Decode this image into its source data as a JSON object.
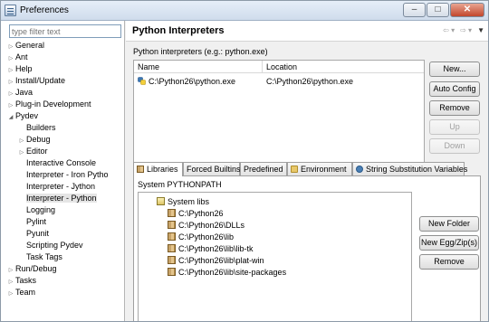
{
  "window": {
    "title": "Preferences"
  },
  "filter": {
    "placeholder": "type filter text"
  },
  "tree": [
    {
      "label": "General",
      "arrow": "▷"
    },
    {
      "label": "Ant",
      "arrow": "▷"
    },
    {
      "label": "Help",
      "arrow": "▷"
    },
    {
      "label": "Install/Update",
      "arrow": "▷"
    },
    {
      "label": "Java",
      "arrow": "▷"
    },
    {
      "label": "Plug-in Development",
      "arrow": "▷"
    },
    {
      "label": "Pydev",
      "arrow": "◢"
    },
    {
      "label": "Builders",
      "arrow": ""
    },
    {
      "label": "Debug",
      "arrow": "▷"
    },
    {
      "label": "Editor",
      "arrow": "▷"
    },
    {
      "label": "Interactive Console",
      "arrow": ""
    },
    {
      "label": "Interpreter - Iron Pytho",
      "arrow": ""
    },
    {
      "label": "Interpreter - Jython",
      "arrow": ""
    },
    {
      "label": "Interpreter - Python",
      "arrow": ""
    },
    {
      "label": "Logging",
      "arrow": ""
    },
    {
      "label": "Pylint",
      "arrow": ""
    },
    {
      "label": "Pyunit",
      "arrow": ""
    },
    {
      "label": "Scripting Pydev",
      "arrow": ""
    },
    {
      "label": "Task Tags",
      "arrow": ""
    },
    {
      "label": "Run/Debug",
      "arrow": "▷"
    },
    {
      "label": "Tasks",
      "arrow": "▷"
    },
    {
      "label": "Team",
      "arrow": "▷"
    }
  ],
  "page": {
    "title": "Python Interpreters",
    "interpreters_label": "Python interpreters (e.g.: python.exe)",
    "table": {
      "headers": [
        "Name",
        "Location"
      ],
      "rows": [
        {
          "name": "C:\\Python26\\python.exe",
          "location": "C:\\Python26\\python.exe"
        }
      ]
    },
    "buttons": {
      "new": "New...",
      "auto_config": "Auto Config",
      "remove": "Remove",
      "up": "Up",
      "down": "Down"
    },
    "tabs": [
      "Libraries",
      "Forced Builtins",
      "Predefined",
      "Environment",
      "String Substitution Variables"
    ],
    "pythonpath_label": "System PYTHONPATH",
    "paths": {
      "root": "System libs",
      "items": [
        "C:\\Python26",
        "C:\\Python26\\DLLs",
        "C:\\Python26\\lib",
        "C:\\Python26\\lib\\lib-tk",
        "C:\\Python26\\lib\\plat-win",
        "C:\\Python26\\lib\\site-packages"
      ]
    },
    "path_buttons": {
      "new_folder": "New Folder",
      "new_egg": "New Egg/Zip(s)",
      "remove": "Remove"
    }
  }
}
